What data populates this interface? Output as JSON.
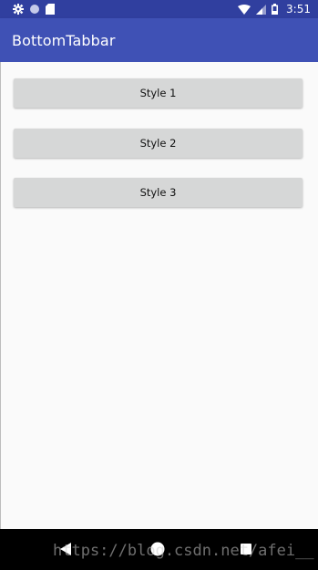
{
  "status_bar": {
    "time": "3:51",
    "icons_left": [
      "gear-icon",
      "circle-icon",
      "sd-card-icon"
    ],
    "icons_right": [
      "wifi-icon",
      "signal-icon",
      "battery-icon"
    ]
  },
  "app_bar": {
    "title": "BottomTabbar"
  },
  "buttons": [
    {
      "label": "Style 1"
    },
    {
      "label": "Style 2"
    },
    {
      "label": "Style 3"
    }
  ],
  "nav_bar": {
    "icons": [
      "back-icon",
      "home-icon",
      "recents-icon"
    ]
  },
  "watermark": "https://blog.csdn.net/afei__",
  "colors": {
    "status_bar": "#303f9f",
    "app_bar": "#3f51b5",
    "background": "#fafafa",
    "button": "#d6d7d7",
    "nav_bar": "#000000"
  }
}
